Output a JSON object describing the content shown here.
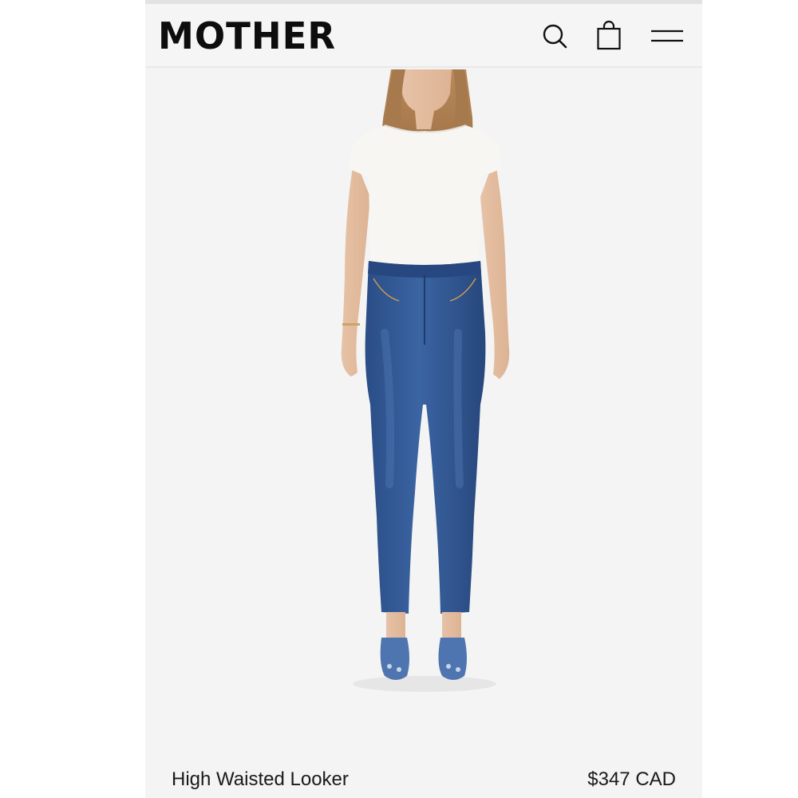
{
  "brand": {
    "logo_text": "MOTHER"
  },
  "header": {
    "icons": {
      "search": "search-icon",
      "bag": "shopping-bag-icon",
      "menu": "hamburger-menu-icon"
    }
  },
  "product": {
    "name": "High Waisted Looker",
    "price": "$347 CAD"
  },
  "colors": {
    "page_bg": "#f4f4f4",
    "text": "#111111",
    "denim": "#2f5590",
    "tee": "#f7f6f2"
  }
}
